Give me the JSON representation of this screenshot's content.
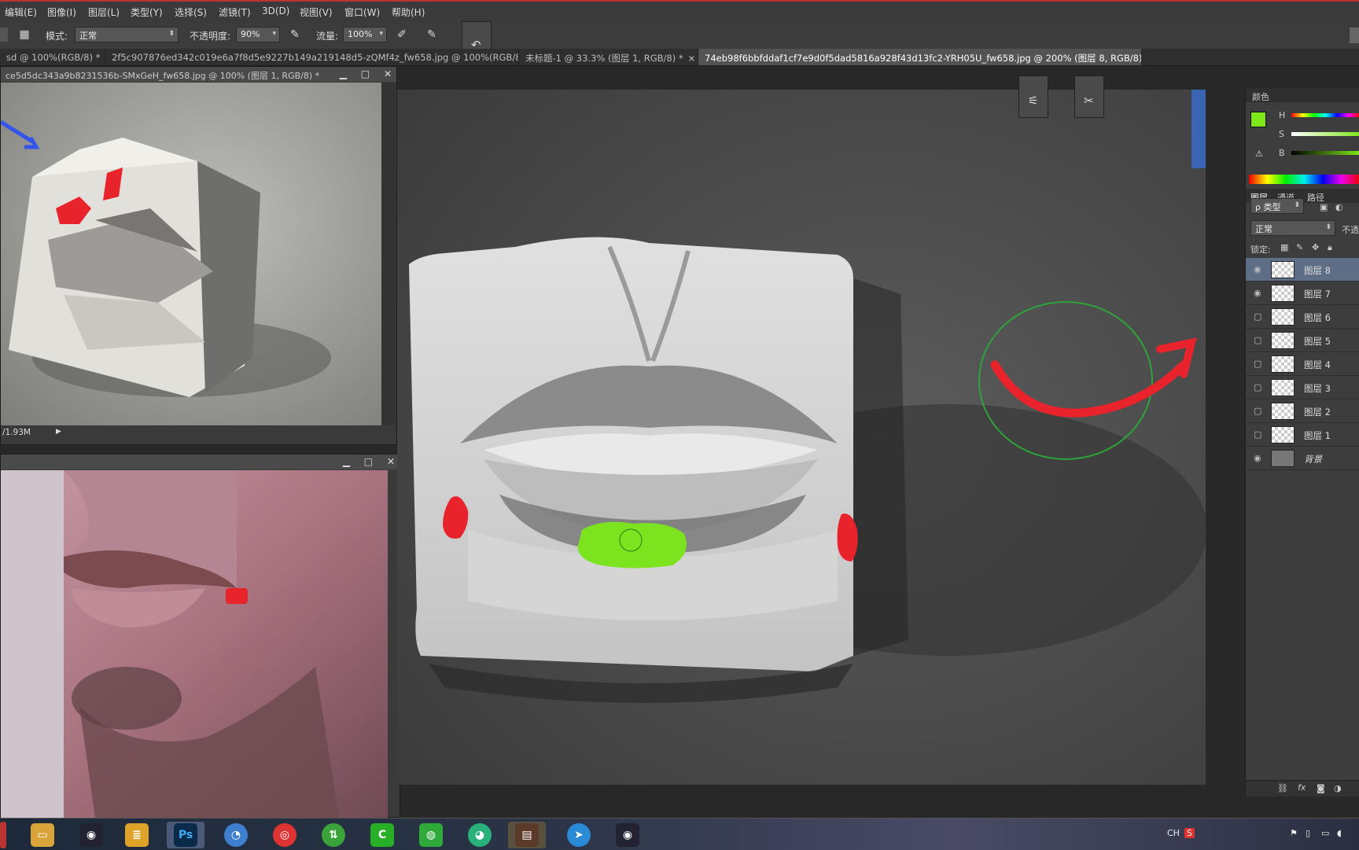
{
  "menu": [
    "编辑(E)",
    "图像(I)",
    "图层(L)",
    "类型(Y)",
    "选择(S)",
    "滤镜(T)",
    "3D(D)",
    "视图(V)",
    "窗口(W)",
    "帮助(H)"
  ],
  "options": {
    "mode_label": "模式:",
    "mode_value": "正常",
    "opacity_label": "不透明度:",
    "opacity_value": "90%",
    "flow_label": "流量:",
    "flow_value": "100%"
  },
  "tabs": [
    {
      "label": "sd @ 100%(RGB/8) *",
      "close": "×",
      "active": false
    },
    {
      "label": "2f5c907876ed342c019e6a7f8d5e9227b149a219148d5-zQMf4z_fw658.jpg @ 100%(RGB/8)",
      "close": "×",
      "active": false
    },
    {
      "label": "未标题-1 @ 33.3% (图层 1, RGB/8) *",
      "close": "×",
      "active": false
    },
    {
      "label": "74eb98f6bbfddaf1cf7e9d0f5dad5816a928f43d13fc2-YRH05U_fw658.jpg @ 200% (图层 8, RGB/8) *",
      "close": "×",
      "active": true
    }
  ],
  "doc_window_1": {
    "title": "ce5d5dc343a9b8231536b-SMxGeH_fw658.jpg @ 100% (图层 1, RGB/8) *",
    "status": "/1.93M",
    "buttons": [
      "▁",
      "□",
      "✕"
    ]
  },
  "doc_window_2": {
    "buttons": [
      "▁",
      "□",
      "✕"
    ]
  },
  "panels": {
    "color_tab": "颜色",
    "hsb": [
      "H",
      "S",
      "B"
    ],
    "layers_tabs": [
      "图层",
      "通道",
      "路径"
    ],
    "filter_kind": "ρ 类型",
    "blend_mode": "正常",
    "opacity_short": "不透",
    "lock_label": "锁定:"
  },
  "layers": [
    {
      "name": "图层 8",
      "visible": true,
      "selected": true
    },
    {
      "name": "图层 7",
      "visible": true,
      "selected": false
    },
    {
      "name": "图层 6",
      "visible": false,
      "selected": false
    },
    {
      "name": "图层 5",
      "visible": false,
      "selected": false
    },
    {
      "name": "图层 4",
      "visible": false,
      "selected": false
    },
    {
      "name": "图层 3",
      "visible": false,
      "selected": false
    },
    {
      "name": "图层 2",
      "visible": false,
      "selected": false
    },
    {
      "name": "图层 1",
      "visible": false,
      "selected": false
    },
    {
      "name": "背景",
      "visible": true,
      "selected": false
    }
  ],
  "taskbar": {
    "apps": [
      "file-explorer",
      "qq",
      "notes",
      "photoshop",
      "browser",
      "music",
      "update",
      "chrome-ext",
      "wechat",
      "iqiyi",
      "photo",
      "mail",
      "qq2"
    ],
    "ps_label": "Ps",
    "tray_lang": "CH",
    "tray_s": "S"
  },
  "colors": {
    "foreground": "#7ee81a",
    "annotation_red": "#e8232b",
    "annotation_green": "#7be41e",
    "highlight": "#5e6e86"
  }
}
